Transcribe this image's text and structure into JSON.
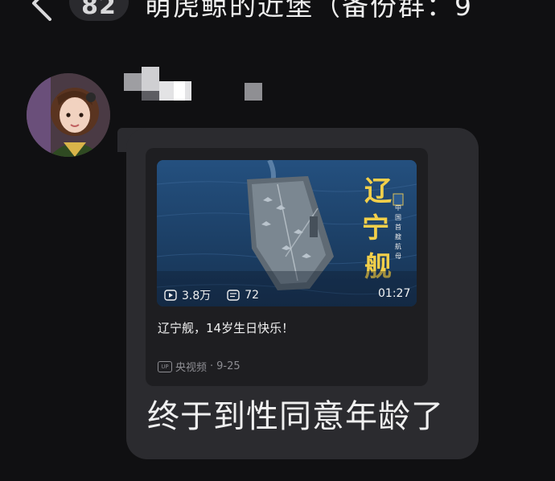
{
  "header": {
    "unread_count": "82",
    "group_title": "萌虎鲸的近堡（备份群：9"
  },
  "message": {
    "shared_video": {
      "thumbnail_text": "辽宁舰",
      "views": "3.8万",
      "comments": "72",
      "duration": "01:27",
      "title": "辽宁舰，14岁生日快乐！",
      "source": "央视频",
      "date": "9-25"
    },
    "text": "终于到性同意年龄了"
  },
  "icons": {
    "back": "chevron-left-icon",
    "play": "play-icon",
    "comment": "comment-icon",
    "up": "up-badge-icon"
  },
  "colors": {
    "background": "#101012",
    "bubble": "#2b2b2f",
    "card": "#1e1e21",
    "sea": "#1a3d66",
    "title_gold": "#f2cf4a"
  }
}
